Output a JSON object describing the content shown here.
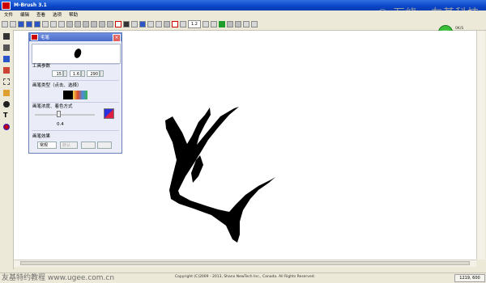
{
  "app": {
    "title": "M-Brush 3.1"
  },
  "watermark": "© 万峣 · 友基科技",
  "menu": [
    "文件",
    "编辑",
    "查看",
    "选项",
    "帮助"
  ],
  "toolbar": {
    "zoom": "1.2"
  },
  "monitor": {
    "badge": "40%",
    "readouts": [
      "0K/S",
      "0K/S"
    ]
  },
  "panel": {
    "title": "毛笔",
    "params_label": "工具参数",
    "params": [
      "15",
      "1.6",
      "290"
    ],
    "brush_type_label": "画笔类型（点击、选择）",
    "opacity_label": "画笔浓度、着色方式",
    "opacity_value": "0.4",
    "effect_label": "画笔效果",
    "effect_select": "常规",
    "effect_disabled": "默认"
  },
  "footer": {
    "site": "友基特约教程 www.ugee.com.cn",
    "copyright": "Copyright (C)2009 - 2013, Shanx NewTech Inc., Canada.  All Rights Reserved.",
    "coords": "1219, 600"
  },
  "colors": {
    "accent": "#0a46c8",
    "ink": "#000000",
    "status_green": "#3bbf3b"
  }
}
